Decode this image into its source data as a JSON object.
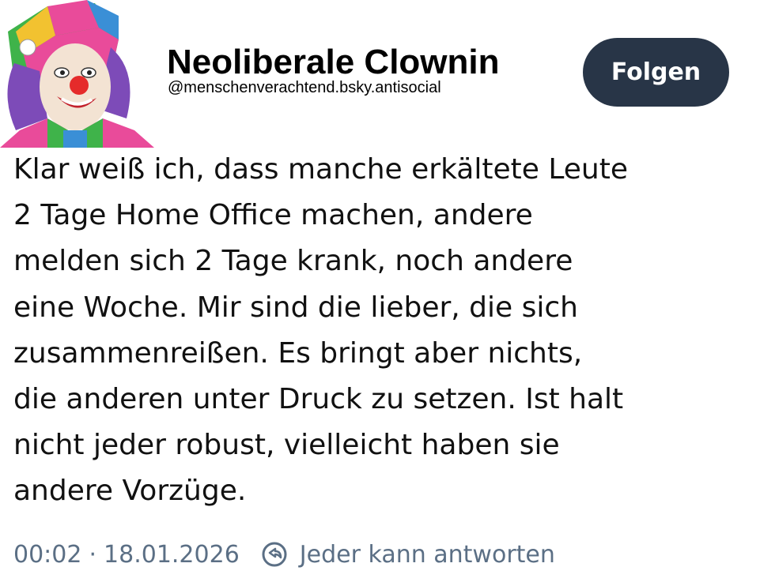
{
  "author": {
    "display_name": "Neoliberale Clownin",
    "handle": "@menschenverachtend.bsky.antisocial",
    "avatar": "clown-avatar"
  },
  "follow_button": {
    "label": "Folgen"
  },
  "post": {
    "lines": [
      "Klar weiß ich, dass manche erkältete Leute",
      "2 Tage Home Office machen, andere",
      "melden sich 2 Tage krank, noch andere",
      "eine Woche. Mir sind die lieber, die sich",
      "zusammenreißen. Es bringt aber nichts,",
      "die anderen unter Druck zu setzen. Ist halt",
      "nicht jeder robust, vielleicht haben sie",
      "andere Vorzüge."
    ]
  },
  "meta": {
    "time": "00:02",
    "separator": "·",
    "date": "18.01.2026",
    "reply_icon": "reply-permission-icon",
    "reply_setting": "Jeder kann antworten"
  },
  "colors": {
    "button_bg": "#283547",
    "meta_text": "#5b6f85"
  }
}
